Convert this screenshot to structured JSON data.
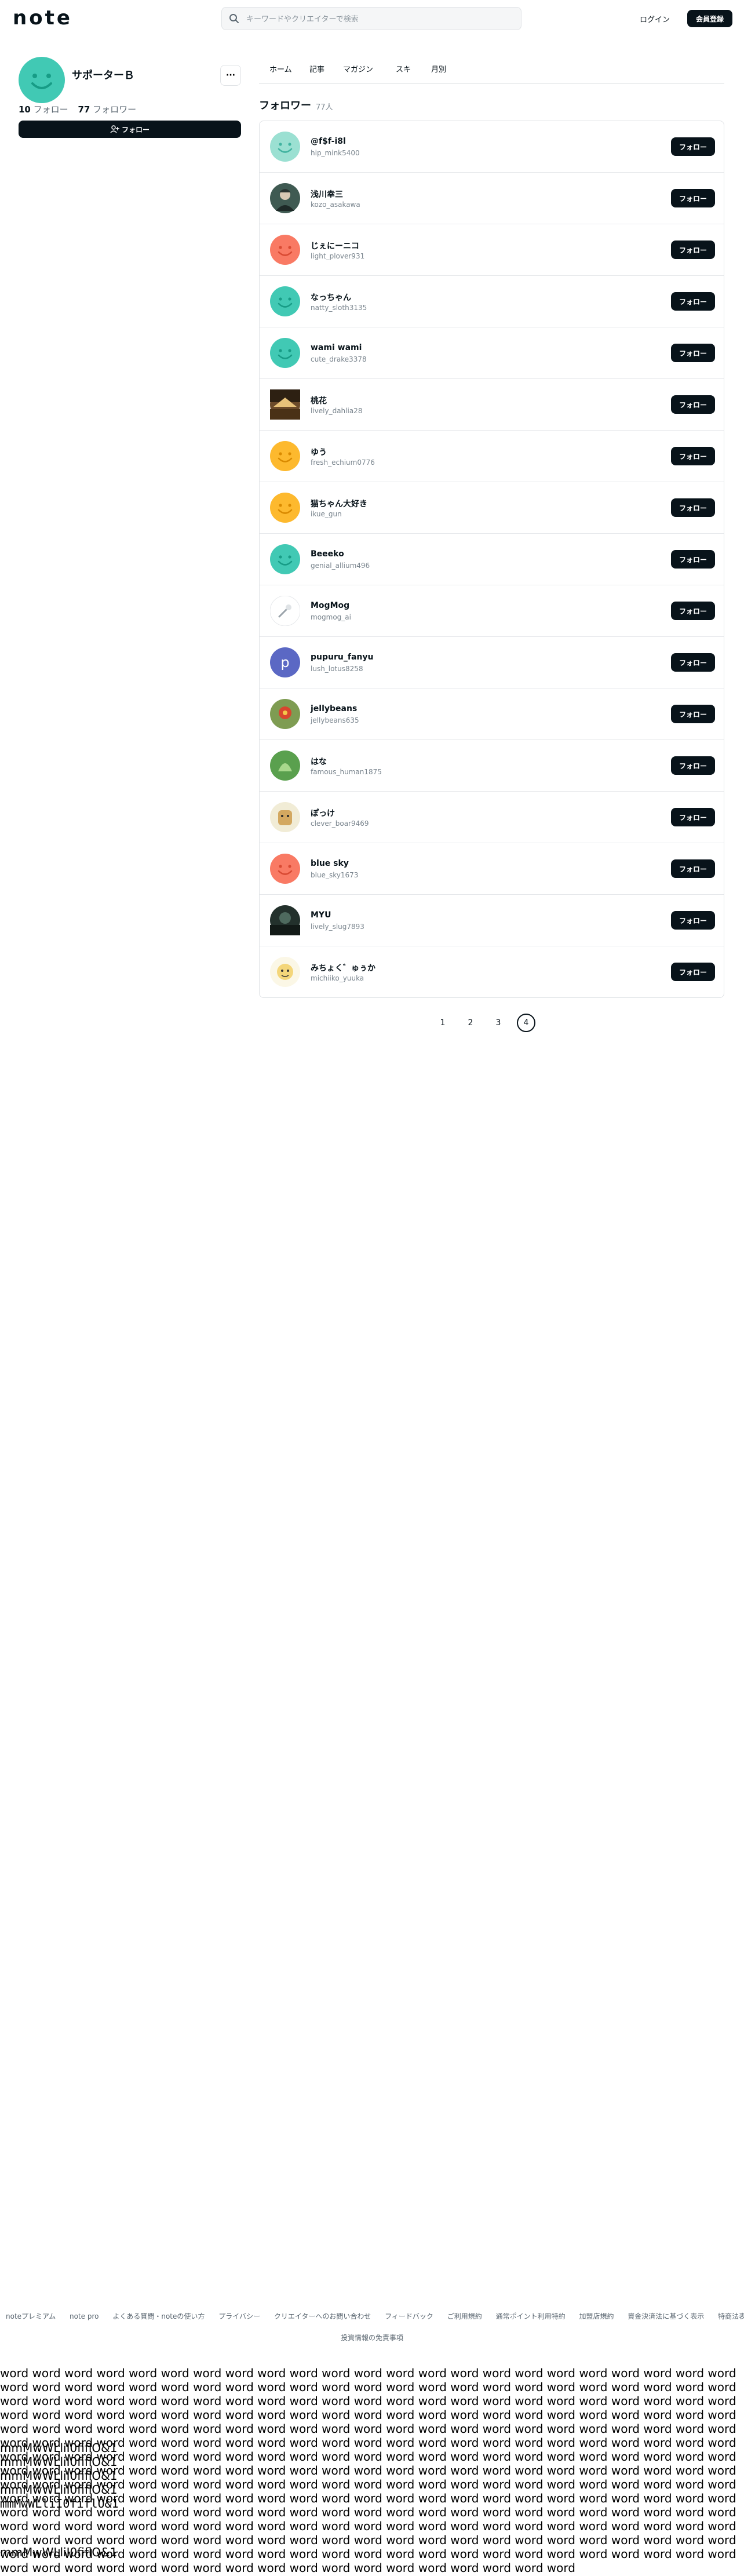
{
  "header": {
    "logo": "note",
    "search_placeholder": "キーワードやクリエイターで検索",
    "login_label": "ログイン",
    "signup_label": "会員登録"
  },
  "profile": {
    "name": "サポーターＢ",
    "more_label": "···",
    "follow_count": "10",
    "follow_label": "フォロー",
    "follower_count": "77",
    "follower_label": "フォロワー",
    "follow_button": "フォロー"
  },
  "tabs": [
    {
      "label": "ホーム"
    },
    {
      "label": "記事"
    },
    {
      "label": "マガジン"
    },
    {
      "label": "スキ"
    },
    {
      "label": "月別"
    }
  ],
  "followers": {
    "title": "フォロワー",
    "count": "77人",
    "button_label": "フォロー",
    "items": [
      {
        "name": "@f$f-i8l",
        "id": "hip_mink5400",
        "avatar": "smile-mint"
      },
      {
        "name": "浅川幸三",
        "id": "kozo_asakawa",
        "avatar": "photo-person"
      },
      {
        "name": "じぇにーニコ",
        "id": "light_plover931",
        "avatar": "smile-salmon"
      },
      {
        "name": "なっちゃん",
        "id": "natty_sloth3135",
        "avatar": "smile-teal"
      },
      {
        "name": "wami wami",
        "id": "cute_drake3378",
        "avatar": "smile-teal"
      },
      {
        "name": "桃花",
        "id": "lively_dahlia28",
        "avatar": "photo-landscape"
      },
      {
        "name": "ゆう",
        "id": "fresh_echium0776",
        "avatar": "smile-yellow"
      },
      {
        "name": "猫ちゃん大好き",
        "id": "ikue_gun",
        "avatar": "smile-yellow"
      },
      {
        "name": "Beeeko",
        "id": "genial_allium496",
        "avatar": "smile-teal"
      },
      {
        "name": "MogMog",
        "id": "mogmog_ai",
        "avatar": "illustration-white"
      },
      {
        "name": "pupuru_fanyu",
        "id": "lush_lotus8258",
        "avatar": "letter-p"
      },
      {
        "name": "jellybeans",
        "id": "jellybeans635",
        "avatar": "photo-flower"
      },
      {
        "name": "はな",
        "id": "famous_human1875",
        "avatar": "photo-green"
      },
      {
        "name": "ぽっけ",
        "id": "clever_boar9469",
        "avatar": "photo-dog"
      },
      {
        "name": "blue sky",
        "id": "blue_sky1673",
        "avatar": "smile-salmon"
      },
      {
        "name": "MYU",
        "id": "lively_slug7893",
        "avatar": "photo-dark"
      },
      {
        "name": "みちょく゛ゅぅか",
        "id": "michiiko_yuuka",
        "avatar": "illustration-anime"
      }
    ]
  },
  "pagination": {
    "pages": [
      "1",
      "2",
      "3",
      "4"
    ],
    "current": "4"
  },
  "footer": {
    "links": [
      "noteプレミアム",
      "note pro",
      "よくある質問・noteの使い方",
      "プライバシー",
      "クリエイターへのお問い合わせ",
      "フィードバック",
      "ご利用規約",
      "通常ポイント利用特約",
      "加盟店規約",
      "資金決済法に基づく表示",
      "特商法表記"
    ],
    "law": "投資情報の免責事項"
  },
  "measure": {
    "words": "word word word word word word word word word word word word word word word word word word word word word word word word word word word word word word word word word word word word word word word word word word word word word word word word word word word word word word word word word word word word word word word word word word word word word word word word word word word word word word word word word word word word word word word word word word word word word word word word word word word word word word word word word word word word word word word word word word word word word word word word word word word word word word word word word word word word word word word word word word word word word word word word word word word word word word word word word word word word word word word word word word word word word word word word word word word word word word word word word word word word word word word word word word word word word word word word word word word word word word word word word word word word word word word word word word word word word word word word word word word word word word word word word word word word word word word word word word word word word word word word word word word word word word word word word word word word word word word word word word word word word word word word word word word word word word word word word word word word word word word word word word word word word word word word word word word word word word word word word word word word word word word word word word word word word word word word word word word word word word word word word word word word word word word word word word word word word word word word word word word word",
    "line1": "mmMwWLliI0fiflO&1",
    "line2": "mmMwWLliI0fiflO&1",
    "line3": "mmMwWLliI0fiflO&1",
    "line4": "mmMwWLliI0fiflO&1",
    "line5": "mmMwWLliI0fiflO&1",
    "line6": "mmMwWLliI0fiflO&1"
  },
  "colors": {
    "primary": "#08131a",
    "mint": "#41c9b4",
    "salmon": "#f97a64",
    "yellow": "#fdb92e",
    "purple": "#5b68c4",
    "border": "#e0e3e6"
  }
}
